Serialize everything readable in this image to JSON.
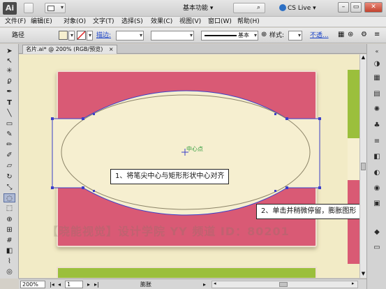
{
  "titlebar": {
    "logo": "Ai",
    "workspace": "基本功能 ▾",
    "cs_live": "CS Live ▾",
    "buttons": {
      "minimize": "–",
      "maximize": "▭",
      "close": "✕"
    }
  },
  "menu": [
    "文件(F)",
    "编辑(E)",
    "对象(O)",
    "文字(T)",
    "选择(S)",
    "效果(C)",
    "视图(V)",
    "窗口(W)",
    "帮助(H)"
  ],
  "control": {
    "object_type": "路径",
    "stroke_label": "描边:",
    "stroke_style": "基本",
    "style_label": "样式:",
    "opacity_label": "不透..."
  },
  "document": {
    "tab_title": "名片.ai* @ 200% (RGB/预览)"
  },
  "canvas": {
    "center_label": "中心点",
    "callout1": "1、将笔尖中心与矩形形状中心对齐",
    "callout2": "2、单击并稍微停留，膨胀图形",
    "watermark": "【晓能视觉】设计学院 YY 频道 ID：80201",
    "colors": {
      "pink": "#d95a74",
      "cream": "#f6efd0",
      "green": "#9bbf3c",
      "canvas": "#f2ebc6",
      "path": "#3b3fc9"
    }
  },
  "status": {
    "zoom": "200%",
    "page": "1",
    "tool_name": "膨胀"
  },
  "tools": [
    "selection-tool",
    "direct-selection-tool",
    "magic-wand-tool",
    "lasso-tool",
    "pen-tool",
    "type-tool",
    "line-tool",
    "rectangle-tool",
    "paintbrush-tool",
    "pencil-tool",
    "blob-brush-tool",
    "eraser-tool",
    "rotate-tool",
    "scale-tool",
    "bloat-tool",
    "free-transform-tool",
    "shape-builder-tool",
    "perspective-tool",
    "mesh-tool",
    "gradient-tool",
    "eyedropper-tool",
    "blend-tool",
    "symbol-sprayer-tool",
    "column-graph-tool",
    "artboard-tool",
    "slice-tool",
    "hand-tool",
    "zoom-tool"
  ]
}
